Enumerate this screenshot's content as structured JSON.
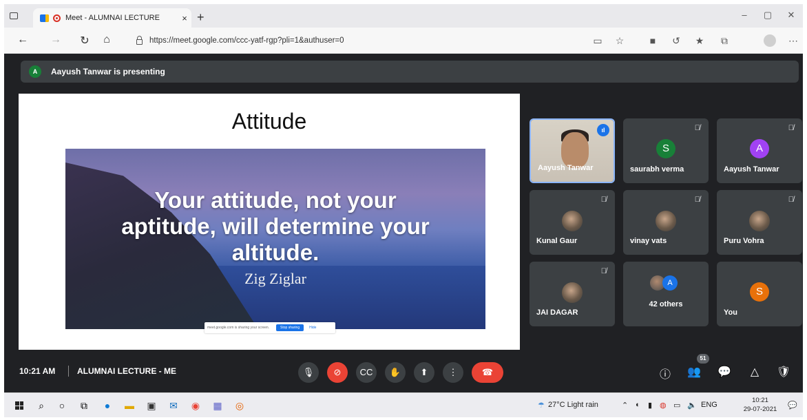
{
  "browser": {
    "tab_title": "Meet - ALUMNAI LECTURE",
    "tab_close": "×",
    "new_tab": "+",
    "url": "https://meet.google.com/ccc-yatf-rgp?pli=1&authuser=0",
    "window_controls": [
      "–",
      "▢",
      "✕"
    ]
  },
  "meet": {
    "presenting_avatar": "A",
    "presenting_text": "Aayush Tanwar is presenting",
    "slide": {
      "title": "Attitude",
      "quote_lines": [
        "Your attitude, not your",
        "aptitude, will determine your",
        "altitude."
      ],
      "author": "Zig Ziglar",
      "share_text": "meet.google.com is sharing your screen.",
      "stop_sharing": "Stop sharing",
      "hide": "Hide"
    },
    "participants": [
      {
        "name": "Aayush Tanwar",
        "type": "video",
        "speaking": true
      },
      {
        "name": "saurabh verma",
        "letter": "S",
        "color": "#188038",
        "muted": true
      },
      {
        "name": "Aayush Tanwar",
        "letter": "A",
        "color": "#a142f4",
        "muted": true
      },
      {
        "name": "Kunal Gaur",
        "type": "photo",
        "muted": true
      },
      {
        "name": "vinay vats",
        "type": "photo",
        "muted": true
      },
      {
        "name": "Puru Vohra",
        "type": "photo",
        "muted": true
      },
      {
        "name": "JAI DAGAR",
        "type": "photo",
        "muted": true
      },
      {
        "name": "42 others",
        "type": "group",
        "group_letter": "A"
      },
      {
        "name": "You",
        "letter": "S",
        "color": "#e8710a"
      }
    ],
    "bottom": {
      "time": "10:21 AM",
      "meeting_name": "ALUMNAI LECTURE - ME",
      "participant_count": "51"
    }
  },
  "taskbar": {
    "weather": "27°C  Light rain",
    "language": "ENG",
    "time": "10:21",
    "date": "29-07-2021"
  }
}
